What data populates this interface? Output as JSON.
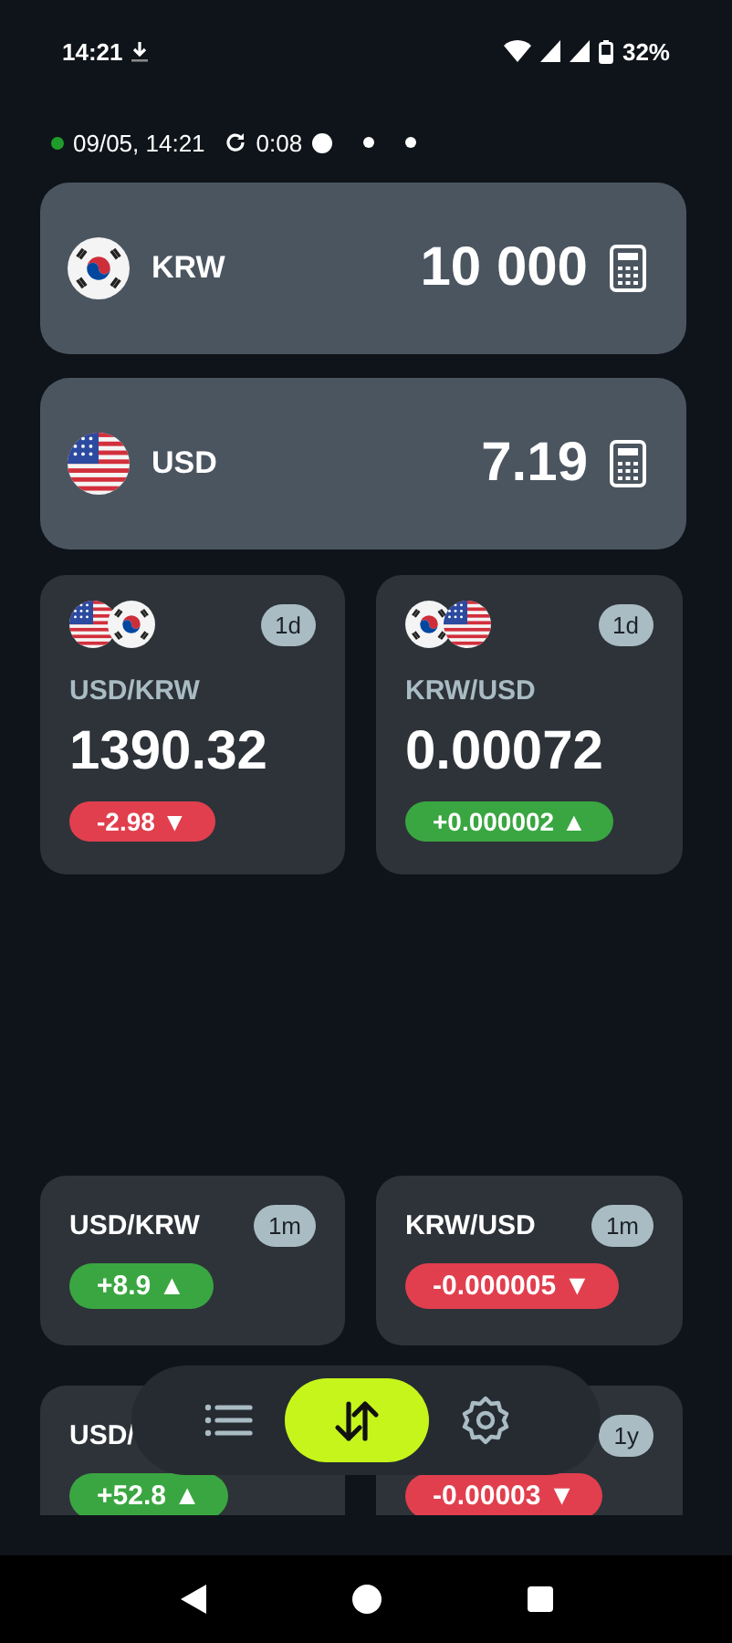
{
  "status_bar": {
    "time": "14:21",
    "battery": "32%"
  },
  "info": {
    "updated": "09/05, 14:21",
    "countdown": "0:08",
    "pages": [
      {
        "selected": true
      },
      {
        "selected": false
      },
      {
        "selected": false
      }
    ]
  },
  "converters": [
    {
      "kind": "kr",
      "code": "KRW",
      "amount": "10 000"
    },
    {
      "kind": "us",
      "code": "USD",
      "amount": "7.19"
    }
  ],
  "rate_tiles": [
    {
      "flags": [
        {
          "kind": "us"
        },
        {
          "kind": "kr"
        }
      ],
      "period": "1d",
      "pair": "USD/KRW",
      "rate": "1390.32",
      "change": {
        "text": "-2.98 ▼",
        "kind": "down"
      }
    },
    {
      "flags": [
        {
          "kind": "kr"
        },
        {
          "kind": "us"
        }
      ],
      "period": "1d",
      "pair": "KRW/USD",
      "rate": "0.00072",
      "change": {
        "text": "+0.000002 ▲",
        "kind": "up"
      }
    }
  ],
  "history_tiles": [
    {
      "pair": "USD/KRW",
      "period": "1m",
      "change": {
        "text": "+8.9 ▲",
        "kind": "up"
      }
    },
    {
      "pair": "KRW/USD",
      "period": "1m",
      "change": {
        "text": "-0.000005 ▼",
        "kind": "down"
      }
    },
    {
      "pair": "USD/",
      "change": {
        "text": "+52.8 ▲",
        "kind": "up"
      }
    },
    {
      "period": "1y",
      "change": {
        "text": "-0.00003 ▼",
        "kind": "down"
      }
    }
  ],
  "nav": [
    {
      "kind": "list",
      "selected": false
    },
    {
      "kind": "swap",
      "selected": true
    },
    {
      "kind": "settings",
      "selected": false
    }
  ]
}
